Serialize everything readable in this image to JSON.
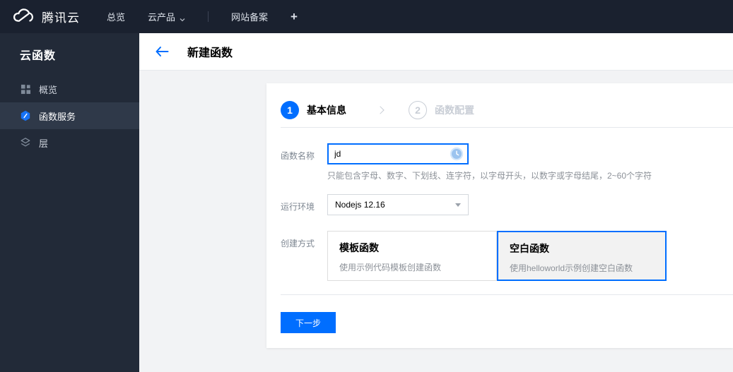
{
  "colors": {
    "accent": "#006eff",
    "topnav_bg": "#1a212f",
    "sidebar_bg": "#222a38",
    "sidebar_active_bg": "#2f3949",
    "content_bg": "#f2f3f5"
  },
  "topnav": {
    "brand": "腾讯云",
    "items": [
      {
        "label": "总览"
      },
      {
        "label": "云产品",
        "has_caret": true
      },
      {
        "label": "网站备案"
      }
    ],
    "add_label": "+"
  },
  "sidebar": {
    "title": "云函数",
    "items": [
      {
        "label": "概览",
        "icon": "grid-icon",
        "active": false
      },
      {
        "label": "函数服务",
        "icon": "function-shield-icon",
        "active": true
      },
      {
        "label": "层",
        "icon": "layers-icon",
        "active": false
      }
    ]
  },
  "header": {
    "title": "新建函数"
  },
  "steps": [
    {
      "number": "1",
      "label": "基本信息",
      "state": "active"
    },
    {
      "number": "2",
      "label": "函数配置",
      "state": "inactive"
    }
  ],
  "form": {
    "function_name": {
      "label": "函数名称",
      "value": "jd",
      "hint": "只能包含字母、数字、下划线、连字符，以字母开头，以数字或字母结尾，2~60个字符",
      "status_icon": "clock-pending-icon"
    },
    "runtime": {
      "label": "运行环境",
      "value": "Nodejs 12.16"
    },
    "creation_method": {
      "label": "创建方式",
      "options": [
        {
          "title": "模板函数",
          "desc": "使用示例代码模板创建函数",
          "selected": false
        },
        {
          "title": "空白函数",
          "desc": "使用helloworld示例创建空白函数",
          "selected": true
        }
      ]
    },
    "next_button_label": "下一步"
  }
}
